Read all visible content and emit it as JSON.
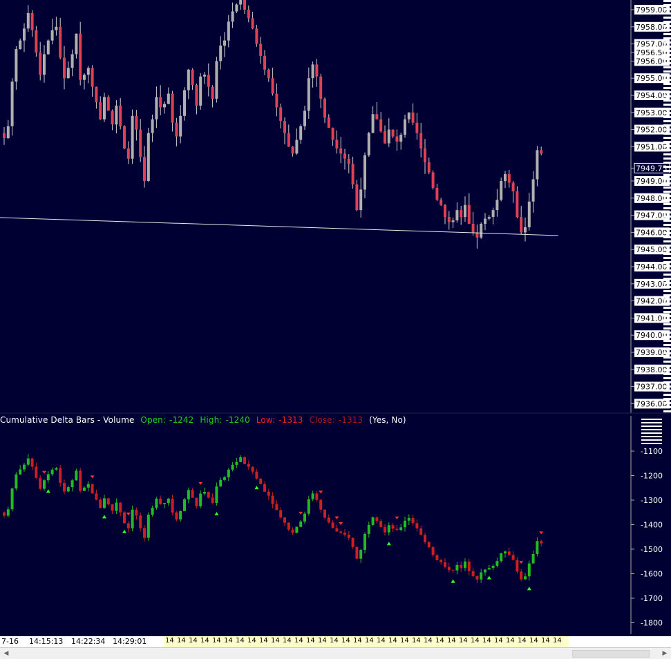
{
  "chart": {
    "background": "#000033",
    "up_color": "#b0b0b0",
    "down_color": "#e04050",
    "delta_up_color": "#22bb22",
    "delta_down_color": "#cc1f1f"
  },
  "price_axis": {
    "labels": [
      "7959.00",
      "7958.00",
      "7957.00",
      "7956.50",
      "7956.00",
      "7955.00",
      "7954.00",
      "7953.00",
      "7952.00",
      "7951.00",
      "7949.75",
      "7949.00",
      "7948.00",
      "7947.00",
      "7946.00",
      "7945.00",
      "7944.00",
      "7943.00",
      "7942.00",
      "7941.00",
      "7940.00",
      "7939.00",
      "7938.00",
      "7937.00",
      "7936.00"
    ],
    "current_price": "7949.75"
  },
  "indicator": {
    "name": "Cumulative Delta Bars - Volume",
    "open_label": "Open:",
    "open_value": "-1242",
    "high_label": "High:",
    "high_value": "-1240",
    "low_label": "Low:",
    "low_value": "-1313",
    "close_label": "Close:",
    "close_value": "-1313",
    "flags": "(Yes, No)"
  },
  "delta_axis": {
    "labels": [
      "-1100",
      "-1200",
      "-1300",
      "-1400",
      "-1500",
      "-1600",
      "-1700",
      "-1800"
    ]
  },
  "time_axis": {
    "labels": [
      "7-16",
      "14:15:13",
      "14:22:34",
      "14:29:01"
    ],
    "overlap_glyph": "14"
  },
  "chart_data": {
    "type": "candlestick",
    "price_y_range": [
      7935.5,
      7960.0
    ],
    "delta_y_range": [
      -1830,
      -1080
    ],
    "ohlc_close": [
      7951.5,
      7952.2,
      7954.8,
      7956.7,
      7957.2,
      7957.9,
      7958.8,
      7957.8,
      7956.5,
      7955.2,
      7956.4,
      7957.2,
      7957.8,
      7958.0,
      7956.2,
      7955.0,
      7955.6,
      7956.4,
      7957.6,
      7954.9,
      7955.2,
      7955.6,
      7954.5,
      7953.6,
      7952.6,
      7953.9,
      7953.1,
      7952.3,
      7953.4,
      7952.2,
      7950.9,
      7950.3,
      7952.8,
      7952.0,
      7950.4,
      7949.0,
      7951.8,
      7952.6,
      7953.9,
      7953.3,
      7953.5,
      7954.1,
      7952.4,
      7951.6,
      7952.8,
      7954.3,
      7955.5,
      7954.6,
      7953.4,
      7955.1,
      7955.2,
      7954.5,
      7953.8,
      7956.0,
      7956.9,
      7957.2,
      7958.3,
      7958.9,
      7959.3,
      7959.8,
      7959.0,
      7958.5,
      7957.9,
      7957.0,
      7956.3,
      7955.5,
      7955.0,
      7954.1,
      7953.3,
      7952.5,
      7951.8,
      7951.0,
      7950.6,
      7951.4,
      7952.2,
      7953.1,
      7955.0,
      7955.8,
      7955.1,
      7953.8,
      7952.7,
      7952.1,
      7951.4,
      7950.9,
      7950.6,
      7950.3,
      7950.0,
      7948.8,
      7947.3,
      7948.5,
      7950.5,
      7951.8,
      7952.9,
      7952.6,
      7951.9,
      7951.2,
      7952.0,
      7951.6,
      7951.3,
      7951.7,
      7952.6,
      7953.0,
      7952.4,
      7951.8,
      7950.9,
      7950.1,
      7949.5,
      7948.6,
      7947.9,
      7947.6,
      7946.9,
      7946.6,
      7946.7,
      7947.3,
      7946.9,
      7947.6,
      7946.5,
      7946.0,
      7945.7,
      7946.5,
      7946.8,
      7946.9,
      7947.3,
      7947.9,
      7949.0,
      7949.4,
      7948.9,
      7948.4,
      7946.9,
      7946.0,
      7946.3,
      7947.8,
      7949.1,
      7950.8,
      7950.6
    ]
  }
}
